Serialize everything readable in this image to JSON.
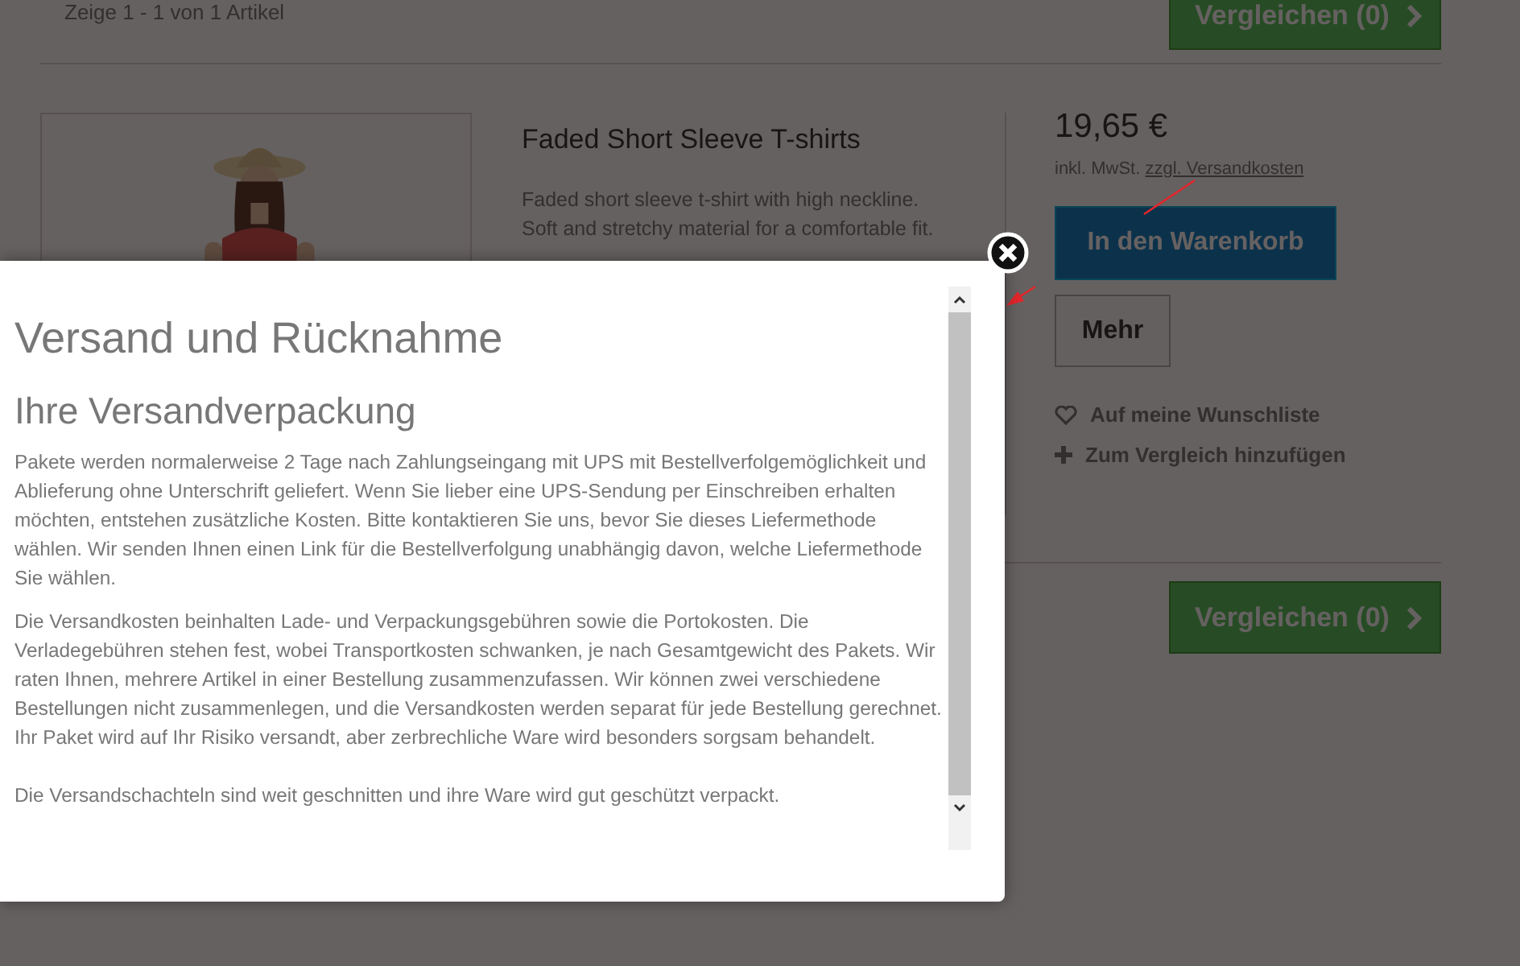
{
  "listing": {
    "count_text": "Zeige 1 - 1 von 1 Artikel",
    "compare_button": "Vergleichen (0)"
  },
  "product": {
    "name": "Faded Short Sleeve T-shirts",
    "description": "Faded short sleeve t-shirt with high neckline. Soft and stretchy material for a comfortable fit.",
    "price": "19,65 €",
    "tax_note": "inkl. MwSt.",
    "shipping_link": "zzgl. Versandkosten",
    "cart_button": "In den Warenkorb",
    "more_button": "Mehr",
    "actions": [
      {
        "kind": "wishlist",
        "label": "Auf meine Wunschliste"
      },
      {
        "kind": "compare",
        "label": "Zum Vergleich hinzufügen"
      }
    ]
  },
  "bottom_compare_button": "Vergleichen (0)",
  "modal": {
    "title": "Versand und Rücknahme",
    "heading": "Ihre Versandverpackung",
    "paragraphs": [
      "Pakete werden normalerweise 2 Tage nach Zahlungseingang mit UPS mit Bestellverfolgemöglichkeit und Ablieferung ohne Unterschrift geliefert. Wenn Sie lieber eine UPS-Sendung per Einschreiben erhalten möchten, entstehen zusätzliche Kosten. Bitte kontaktieren Sie uns, bevor Sie dieses Liefermethode wählen. Wir senden Ihnen einen Link für die Bestellverfolgung unabhängig davon, welche Liefermethode Sie wählen.",
      "Die Versandkosten beinhalten Lade- und Verpackungsgebühren sowie die Portokosten. Die Verladegebühren stehen fest, wobei Transportkosten schwanken, je nach Gesamtgewicht des Pakets. Wir raten Ihnen, mehrere Artikel in einer Bestellung zusammenzufassen. Wir können zwei verschiedene Bestellungen nicht zusammenlegen, und die Versandkosten werden separat für jede Bestellung gerechnet. Ihr Paket wird auf Ihr Risiko versandt, aber zerbrechliche Ware wird besonders sorgsam behandelt.",
      "Die Versandschachteln sind weit geschnitten und ihre Ware wird gut geschützt verpackt."
    ]
  }
}
